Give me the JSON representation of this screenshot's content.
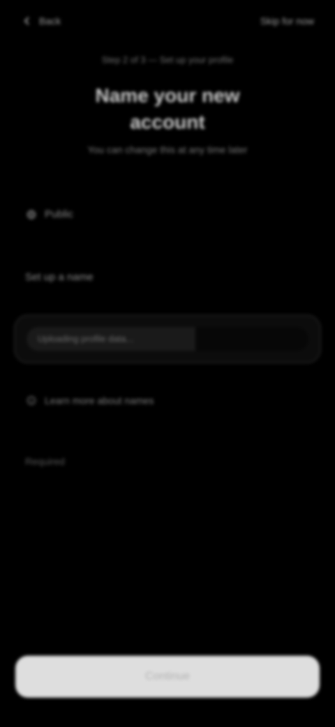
{
  "header": {
    "back_label": "Back",
    "action_label": "Skip for now"
  },
  "step_label": "Step 2 of 3 — Set up your profile",
  "title": "Name your new account",
  "subtitle": "You can change this at any time later",
  "option": {
    "label": "Public",
    "icon": "globe-icon"
  },
  "section_label": "Set up a name",
  "progress": {
    "text": "Uploading profile data...",
    "value": 0.6
  },
  "link": {
    "label": "Learn more about names",
    "icon": "info-icon"
  },
  "status_text": "Required",
  "primary_button": {
    "label": "Continue"
  },
  "colors": {
    "background": "#000000",
    "button": "#dedede"
  }
}
